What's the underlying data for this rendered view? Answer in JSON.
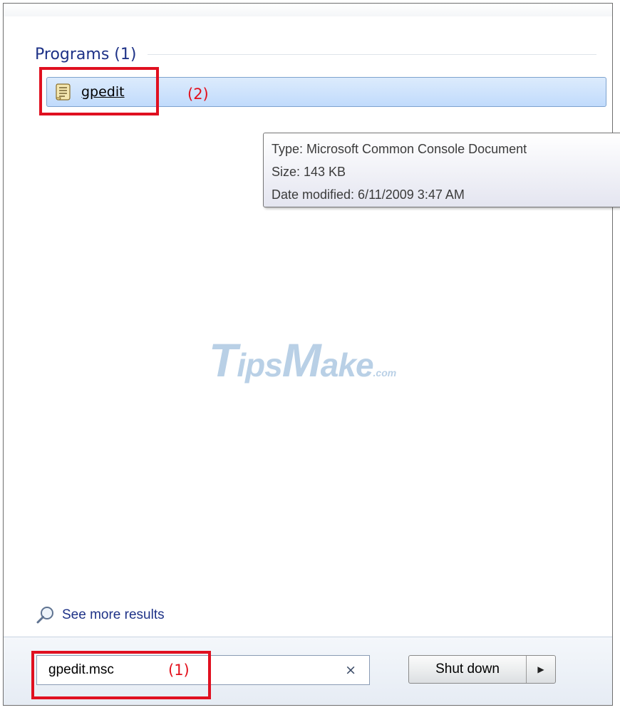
{
  "programs_header": {
    "title": "Programs (1)"
  },
  "results": [
    {
      "label": "gpedit",
      "icon": "console-document-icon"
    }
  ],
  "annotations": {
    "step1": "(1)",
    "step2": "(2)",
    "highlight_color": "#e01020"
  },
  "tooltip": {
    "type_line": "Type: Microsoft Common Console Document",
    "size_line": "Size: 143 KB",
    "date_line": "Date modified: 6/11/2009 3:47 AM"
  },
  "watermark": {
    "part1": "T",
    "part2": "ips",
    "part3": "M",
    "part4": "ake",
    "part5": ".com"
  },
  "see_more": {
    "label": "See more results",
    "icon": "magnifier-icon"
  },
  "search": {
    "value": "gpedit.msc",
    "clear_glyph": "×"
  },
  "shutdown": {
    "label": "Shut down",
    "arrow": "▶"
  },
  "colors": {
    "link_blue": "#1e3287",
    "selection_blue": "#c1dbfc"
  }
}
